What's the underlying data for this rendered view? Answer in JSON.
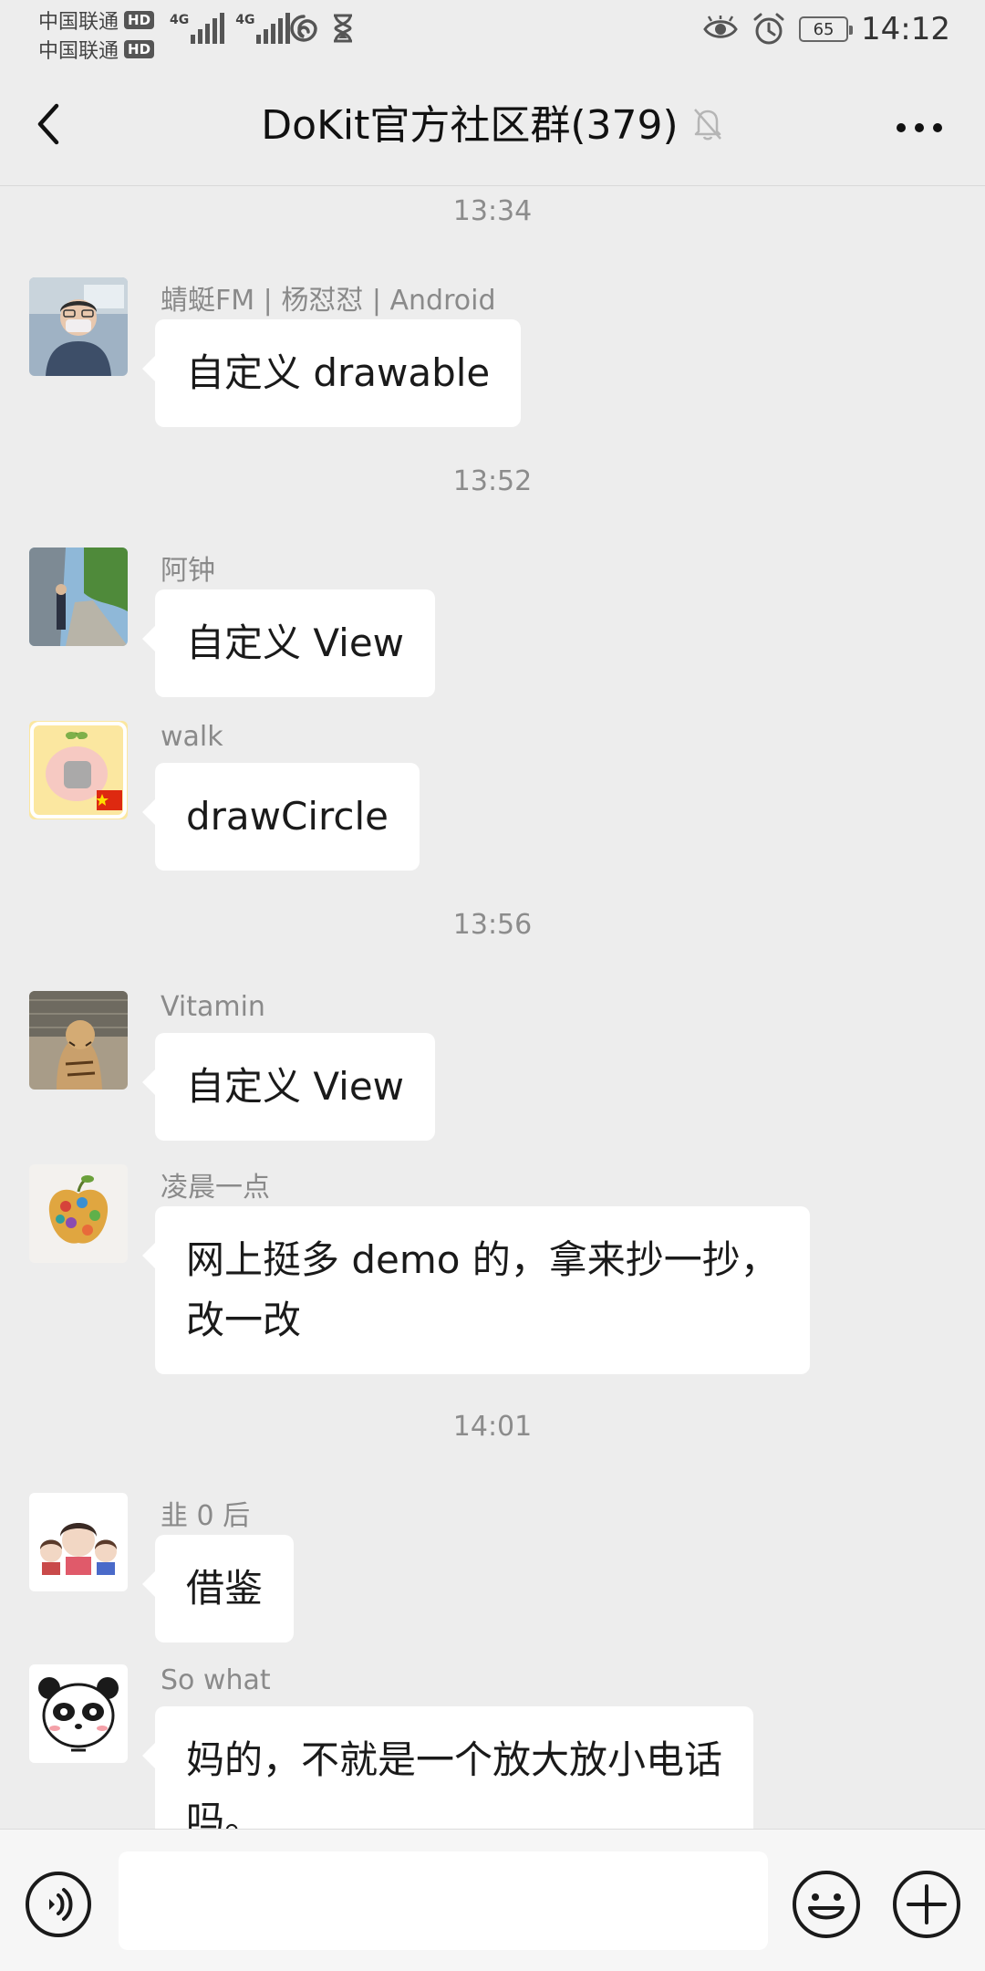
{
  "status_bar": {
    "carrier_1": "中国联通",
    "carrier_2": "中国联通",
    "hd_label": "HD",
    "network_1": "4G",
    "network_2": "4G",
    "battery_level": "65",
    "time": "14:12"
  },
  "nav": {
    "title": "DoKit官方社区群(379)",
    "back_icon": "chevron-left-icon",
    "mute_icon": "bell-off-icon",
    "more_icon": "more-horizontal-icon"
  },
  "messages": [
    {
      "type": "time",
      "text": "13:34"
    },
    {
      "type": "msg",
      "sender": "蜻蜓FM | 杨怼怼 | Android",
      "lines": [
        "自定义 drawable"
      ]
    },
    {
      "type": "time",
      "text": "13:52"
    },
    {
      "type": "msg",
      "sender": "阿钟",
      "lines": [
        "自定义 View"
      ]
    },
    {
      "type": "msg",
      "sender": "walk",
      "lines": [
        "drawCircle"
      ]
    },
    {
      "type": "time",
      "text": "13:56"
    },
    {
      "type": "msg",
      "sender": "Vitamin",
      "lines": [
        "自定义 View"
      ]
    },
    {
      "type": "msg",
      "sender": "凌晨一点",
      "lines": [
        "网上挺多 demo 的，拿来抄一抄，",
        "改一改"
      ]
    },
    {
      "type": "time",
      "text": "14:01"
    },
    {
      "type": "msg",
      "sender": "韭 0 后",
      "lines": [
        "借鉴"
      ]
    },
    {
      "type": "msg",
      "sender": "So what",
      "lines": [
        "妈的，不就是一个放大放小电话",
        "吗。"
      ]
    }
  ],
  "input_bar": {
    "voice_icon": "voice-icon",
    "text_value": "",
    "emoji_icon": "emoji-icon",
    "plus_icon": "plus-circle-icon"
  },
  "colors": {
    "background": "#ededed",
    "bubble": "#ffffff",
    "input_bar": "#f6f6f6",
    "meta_text": "#8c8c8c"
  }
}
